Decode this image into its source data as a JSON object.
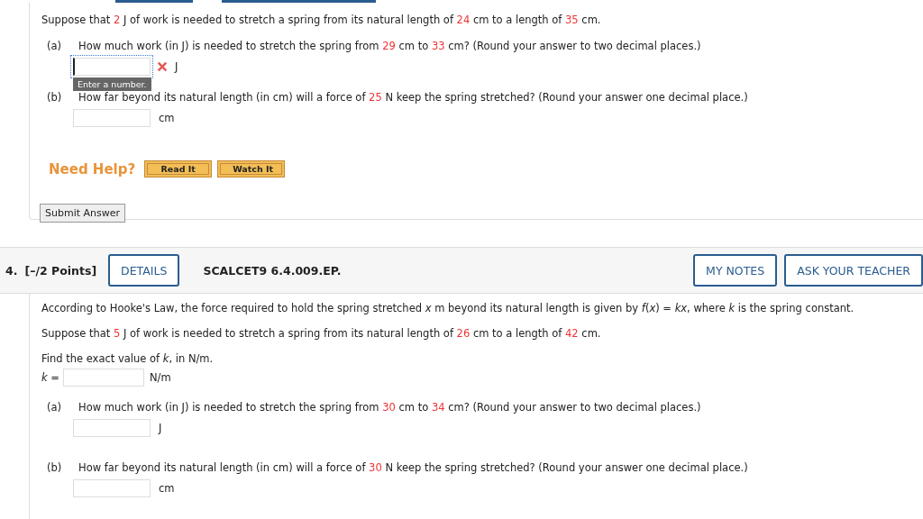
{
  "previous_question": {
    "intro": [
      {
        "text": "Suppose that "
      },
      {
        "text": "2",
        "highlight": true
      },
      {
        "text": " J of work is needed to stretch a spring from its natural length of "
      },
      {
        "text": "24",
        "highlight": true
      },
      {
        "text": " cm to a length of "
      },
      {
        "text": "35",
        "highlight": true
      },
      {
        "text": " cm."
      }
    ],
    "parts": [
      {
        "label": "(a)",
        "question": [
          {
            "text": "How much work (in J) is needed to stretch the spring from "
          },
          {
            "text": "29",
            "highlight": true
          },
          {
            "text": " cm to "
          },
          {
            "text": "33",
            "highlight": true
          },
          {
            "text": " cm? (Round your answer to two decimal places.)"
          }
        ],
        "answer": {
          "unit": "J",
          "focused": true,
          "invalid": true,
          "tooltip": "Enter a number."
        }
      },
      {
        "label": "(b)",
        "question": [
          {
            "text": "How far beyond its natural length (in cm) will a force of "
          },
          {
            "text": "25",
            "highlight": true
          },
          {
            "text": " N keep the spring stretched? (Round your answer one decimal place.)"
          }
        ],
        "answer": {
          "unit": "cm",
          "focused": false,
          "invalid": false
        }
      }
    ],
    "need_help": {
      "label": "Need Help?",
      "buttons": [
        "Read It",
        "Watch It"
      ]
    },
    "submit": "Submit Answer"
  },
  "question": {
    "header": {
      "number": "4.",
      "points": "[–/2 Points]",
      "details": "DETAILS",
      "code": "SCALCET9 6.4.009.EP.",
      "buttons": [
        "MY NOTES",
        "ASK YOUR TEACHER"
      ]
    },
    "paragraphs": [
      [
        {
          "text": "According to Hooke's Law, the force required to hold the spring stretched *x* m beyond its natural length is given by *f*(*x*) = *kx*, where *k* is the spring constant."
        }
      ],
      [
        {
          "text": "Suppose that "
        },
        {
          "text": "5",
          "highlight": true
        },
        {
          "text": " J of work is needed to stretch a spring from its natural length of "
        },
        {
          "text": "26",
          "highlight": true
        },
        {
          "text": " cm to a length of "
        },
        {
          "text": "42",
          "highlight": true
        },
        {
          "text": " cm."
        }
      ],
      [
        {
          "text": "Find the exact value of *k*, in N/m."
        }
      ]
    ],
    "k_field": {
      "label": "*k* =",
      "unit": "N/m"
    },
    "parts": [
      {
        "label": "(a)",
        "question": [
          {
            "text": "How much work (in J) is needed to stretch the spring from "
          },
          {
            "text": "30",
            "highlight": true
          },
          {
            "text": " cm to "
          },
          {
            "text": "34",
            "highlight": true
          },
          {
            "text": " cm? (Round your answer to two decimal places.)"
          }
        ],
        "answer": {
          "unit": "J",
          "focused": false,
          "invalid": false
        }
      },
      {
        "label": "(b)",
        "question": [
          {
            "text": "How far beyond its natural length (in cm) will a force of "
          },
          {
            "text": "30",
            "highlight": true
          },
          {
            "text": " N keep the spring stretched? (Round your answer one decimal place.)"
          }
        ],
        "answer": {
          "unit": "cm",
          "focused": false,
          "invalid": false
        }
      }
    ]
  }
}
